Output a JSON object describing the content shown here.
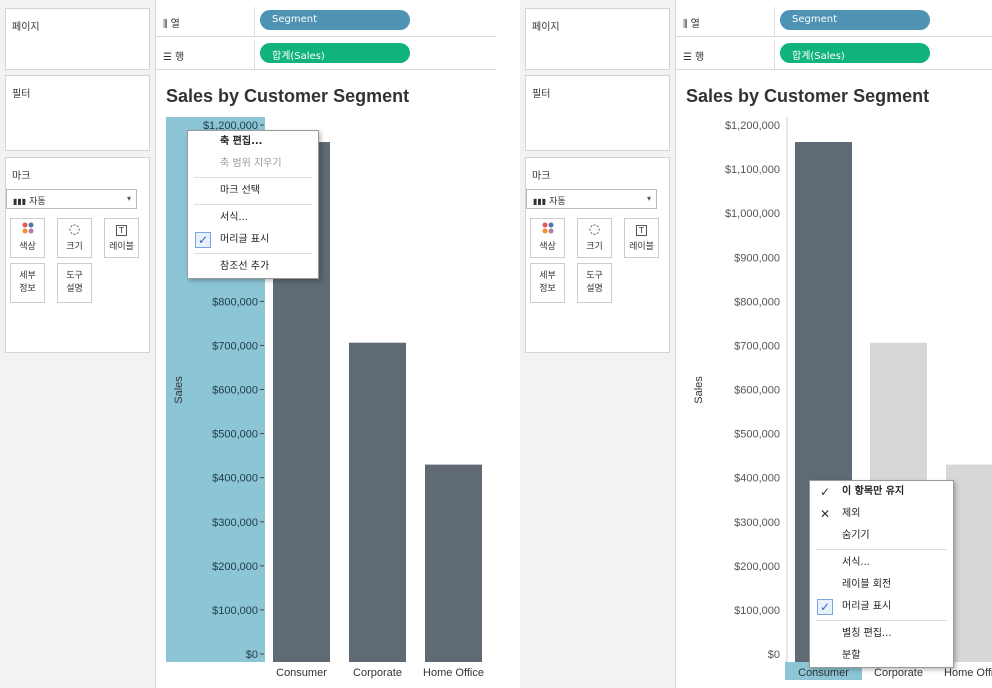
{
  "shared": {
    "pages_label": "페이지",
    "filters_label": "필터",
    "marks_label": "마크",
    "columns_label": "열",
    "rows_label": "행",
    "columns_pill": "Segment",
    "rows_pill": "합계(Sales)",
    "mark_type": "자동",
    "mark_buttons": {
      "color": "색상",
      "size": "크기",
      "label": "레이블",
      "detail_line1": "세부",
      "detail_line2": "정보",
      "tooltip_line1": "도구",
      "tooltip_line2": "설명"
    },
    "chart_title": "Sales by Customer Segment",
    "y_axis_label": "Sales"
  },
  "chart_data": {
    "type": "bar",
    "title": "Sales by Customer Segment",
    "xlabel": "",
    "ylabel": "Sales",
    "categories": [
      "Consumer",
      "Corporate",
      "Home Office"
    ],
    "values": [
      1161401,
      706146,
      429653
    ],
    "ylim": [
      0,
      1200000
    ],
    "y_ticks": [
      "$0",
      "$100,000",
      "$200,000",
      "$300,000",
      "$400,000",
      "$500,000",
      "$600,000",
      "$700,000",
      "$800,000",
      "$900,000",
      "$1,000,000",
      "$1,100,000",
      "$1,200,000"
    ],
    "colors": {
      "bar": "#5f6a74",
      "bar_dimmed": "#d6d7d9",
      "axis_highlight": "#8cc5d6",
      "category_highlight": "#8cc5d6"
    }
  },
  "left_menu": {
    "items": [
      {
        "label": "축 편집...",
        "style": "bold"
      },
      {
        "label": "축 범위 지우기",
        "style": "disabled"
      },
      {
        "label": "마크 선택",
        "style": "normal"
      },
      {
        "label": "서식...",
        "style": "normal"
      },
      {
        "label": "머리글 표시",
        "style": "checked"
      },
      {
        "label": "참조선 추가",
        "style": "normal"
      }
    ]
  },
  "right_menu": {
    "items": [
      {
        "label": "이 항목만 유지",
        "style": "bold-check"
      },
      {
        "label": "제외",
        "style": "x"
      },
      {
        "label": "숨기기",
        "style": "normal"
      },
      {
        "label": "서식...",
        "style": "normal"
      },
      {
        "label": "레이블 회전",
        "style": "normal"
      },
      {
        "label": "머리글 표시",
        "style": "checked"
      },
      {
        "label": "별칭 편집...",
        "style": "normal"
      },
      {
        "label": "분할",
        "style": "normal"
      }
    ]
  }
}
